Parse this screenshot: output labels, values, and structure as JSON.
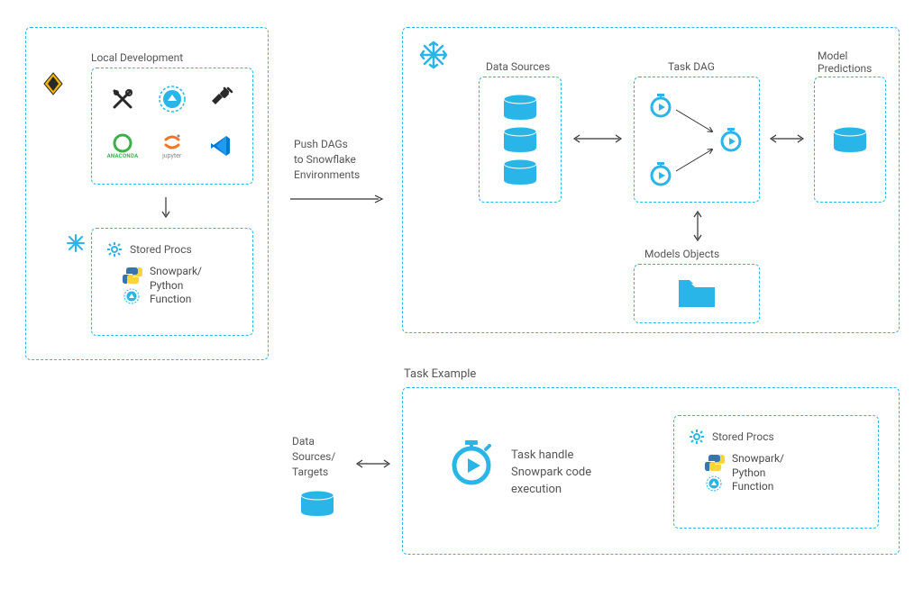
{
  "local_dev": {
    "title": "Local Development",
    "tools": [
      "tools-icon",
      "streamlit-icon",
      "plug-icon",
      "anaconda-icon",
      "jupyter-icon",
      "vscode-icon"
    ]
  },
  "stored_procs": {
    "title": "Stored Procs",
    "body": "Snowpark/\nPython\nFunction"
  },
  "push_label": "Push DAGs\nto Snowflake\nEnvironments",
  "snowflake_env": {
    "data_sources": "Data Sources",
    "task_dag": "Task DAG",
    "model_predictions": "Model\nPredictions",
    "models_objects": "Models Objects"
  },
  "task_example": {
    "title": "Task Example",
    "data_label": "Data\nSources/\nTargets",
    "task_text": "Task handle\nSnowpark code\nexecution",
    "stored_procs_title": "Stored Procs",
    "stored_procs_body": "Snowpark/\nPython\nFunction"
  },
  "colors": {
    "brand": "#29b5e8",
    "text": "#4a4a4a"
  }
}
